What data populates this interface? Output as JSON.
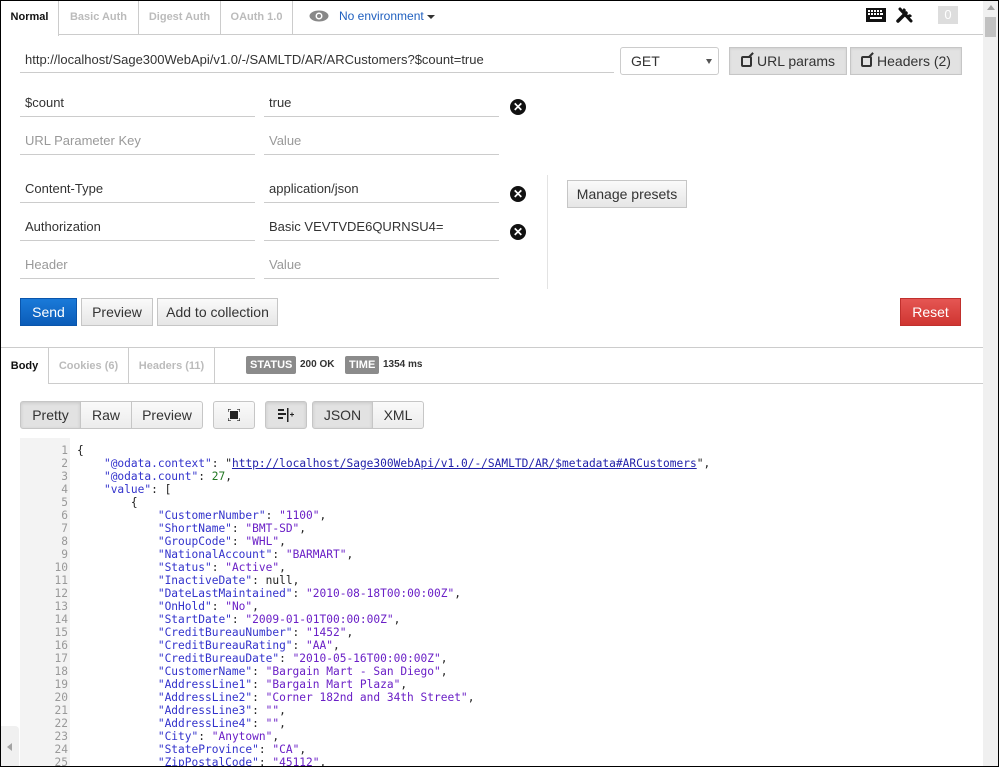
{
  "auth_tabs": [
    {
      "label": "Normal",
      "active": true
    },
    {
      "label": "Basic Auth",
      "active": false
    },
    {
      "label": "Digest Auth",
      "active": false
    },
    {
      "label": "OAuth 1.0",
      "active": false
    }
  ],
  "environment": {
    "label": "No environment"
  },
  "top_icons": {
    "keyboard": "keyboard-icon",
    "settings": "wrench-icon",
    "notification_count": "0"
  },
  "request": {
    "url": "http://localhost/Sage300WebApi/v1.0/-/SAMLTD/AR/ARCustomers?$count=true",
    "method": "GET",
    "url_params_label": "URL params",
    "headers_label": "Headers (2)"
  },
  "url_params": {
    "rows": [
      {
        "key": "$count",
        "value": "true"
      }
    ],
    "key_placeholder": "URL Parameter Key",
    "value_placeholder": "Value"
  },
  "headers": {
    "rows": [
      {
        "key": "Content-Type",
        "value": "application/json"
      },
      {
        "key": "Authorization",
        "value": "Basic VEVTVDE6QURNSU4="
      }
    ],
    "key_placeholder": "Header",
    "value_placeholder": "Value",
    "manage_presets_label": "Manage presets"
  },
  "actions": {
    "send": "Send",
    "preview": "Preview",
    "add_to_collection": "Add to collection",
    "reset": "Reset"
  },
  "response": {
    "tabs": [
      {
        "label": "Body",
        "active": true
      },
      {
        "label": "Cookies (6)",
        "active": false
      },
      {
        "label": "Headers (11)",
        "active": false
      }
    ],
    "status_label": "STATUS",
    "status_value": "200 OK",
    "time_label": "TIME",
    "time_value": "1354 ms",
    "view_modes": [
      "Pretty",
      "Raw",
      "Preview"
    ],
    "active_view": "Pretty",
    "formats": [
      "JSON",
      "XML"
    ],
    "active_format": "JSON"
  },
  "body_lines": [
    {
      "n": "1",
      "indent": 0,
      "html": "{"
    },
    {
      "n": "2",
      "indent": 1,
      "key": "@odata.context",
      "link": "http://localhost/Sage300WebApi/v1.0/-/SAMLTD/AR/$metadata#ARCustomers",
      "tail": ","
    },
    {
      "n": "3",
      "indent": 1,
      "key": "@odata.count",
      "num": "27",
      "tail": ","
    },
    {
      "n": "4",
      "indent": 1,
      "key": "value",
      "raw": "[",
      "tail": ""
    },
    {
      "n": "5",
      "indent": 2,
      "html": "{"
    },
    {
      "n": "6",
      "indent": 3,
      "key": "CustomerNumber",
      "str": "1100",
      "tail": ","
    },
    {
      "n": "7",
      "indent": 3,
      "key": "ShortName",
      "str": "BMT-SD",
      "tail": ","
    },
    {
      "n": "8",
      "indent": 3,
      "key": "GroupCode",
      "str": "WHL",
      "tail": ","
    },
    {
      "n": "9",
      "indent": 3,
      "key": "NationalAccount",
      "str": "BARMART",
      "tail": ","
    },
    {
      "n": "10",
      "indent": 3,
      "key": "Status",
      "str": "Active",
      "tail": ","
    },
    {
      "n": "11",
      "indent": 3,
      "key": "InactiveDate",
      "raw": "null",
      "tail": ","
    },
    {
      "n": "12",
      "indent": 3,
      "key": "DateLastMaintained",
      "str": "2010-08-18T00:00:00Z",
      "tail": ","
    },
    {
      "n": "13",
      "indent": 3,
      "key": "OnHold",
      "str": "No",
      "tail": ","
    },
    {
      "n": "14",
      "indent": 3,
      "key": "StartDate",
      "str": "2009-01-01T00:00:00Z",
      "tail": ","
    },
    {
      "n": "15",
      "indent": 3,
      "key": "CreditBureauNumber",
      "str": "1452",
      "tail": ","
    },
    {
      "n": "16",
      "indent": 3,
      "key": "CreditBureauRating",
      "str": "AA",
      "tail": ","
    },
    {
      "n": "17",
      "indent": 3,
      "key": "CreditBureauDate",
      "str": "2010-05-16T00:00:00Z",
      "tail": ","
    },
    {
      "n": "18",
      "indent": 3,
      "key": "CustomerName",
      "str": "Bargain Mart - San Diego",
      "tail": ","
    },
    {
      "n": "19",
      "indent": 3,
      "key": "AddressLine1",
      "str": "Bargain Mart Plaza",
      "tail": ","
    },
    {
      "n": "20",
      "indent": 3,
      "key": "AddressLine2",
      "str": "Corner 182nd and 34th Street",
      "tail": ","
    },
    {
      "n": "21",
      "indent": 3,
      "key": "AddressLine3",
      "str": "",
      "tail": ","
    },
    {
      "n": "22",
      "indent": 3,
      "key": "AddressLine4",
      "str": "",
      "tail": ","
    },
    {
      "n": "23",
      "indent": 3,
      "key": "City",
      "str": "Anytown",
      "tail": ","
    },
    {
      "n": "24",
      "indent": 3,
      "key": "StateProvince",
      "str": "CA",
      "tail": ","
    },
    {
      "n": "25",
      "indent": 3,
      "key": "ZipPostalCode",
      "str": "45112",
      "tail": ","
    }
  ]
}
